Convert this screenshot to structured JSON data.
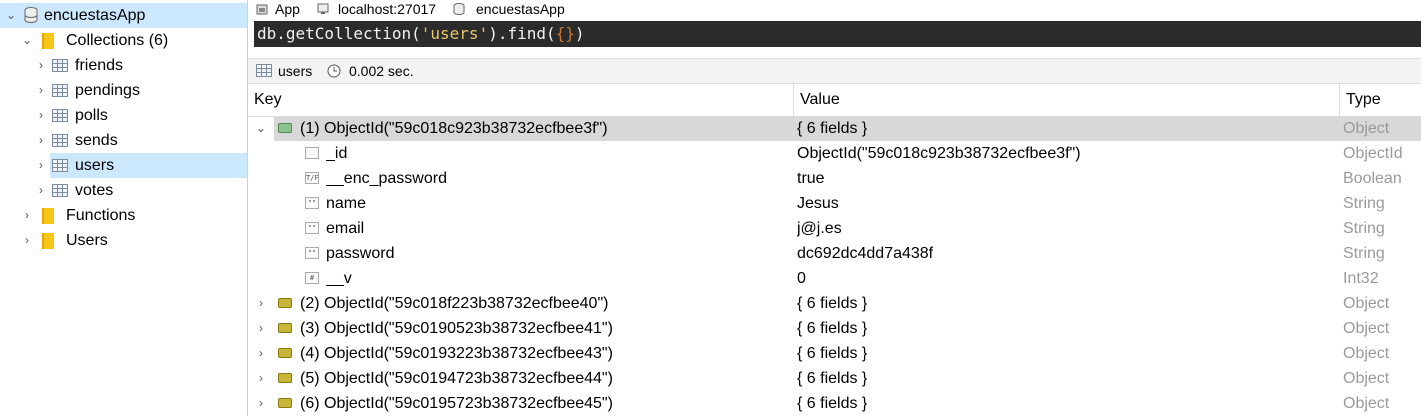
{
  "sidebar": {
    "db_name": "encuestasApp",
    "collections_label": "Collections (6)",
    "collections": [
      "friends",
      "pendings",
      "polls",
      "sends",
      "users",
      "votes"
    ],
    "selected_collection": "users",
    "functions_label": "Functions",
    "users_label": "Users"
  },
  "connection": {
    "app": "App",
    "host": "localhost:27017",
    "db": "encuestasApp"
  },
  "query": {
    "prefix": "db.getCollection(",
    "collection": "'users'",
    "mid": ").find(",
    "arg": "{}",
    "suffix": ")"
  },
  "status": {
    "collection": "users",
    "time": "0.002 sec."
  },
  "grid": {
    "columns": [
      "Key",
      "Value",
      "Type"
    ],
    "expanded": {
      "key": "(1) ObjectId(\"59c018c923b38732ecfbee3f\")",
      "value": "{ 6 fields }",
      "type": "Object",
      "fields": [
        {
          "icon": "objectid-field-icon",
          "glyph": "",
          "key": "_id",
          "value": "ObjectId(\"59c018c923b38732ecfbee3f\")",
          "type": "ObjectId"
        },
        {
          "icon": "boolean-field-icon",
          "glyph": "T/F",
          "key": "__enc_password",
          "value": "true",
          "type": "Boolean"
        },
        {
          "icon": "string-field-icon",
          "glyph": "\"\"",
          "key": "name",
          "value": "Jesus",
          "type": "String"
        },
        {
          "icon": "string-field-icon",
          "glyph": "\"\"",
          "key": "email",
          "value": "j@j.es",
          "type": "String"
        },
        {
          "icon": "string-field-icon",
          "glyph": "\"\"",
          "key": "password",
          "value": "dc692dc4dd7a438f",
          "type": "String"
        },
        {
          "icon": "int-field-icon",
          "glyph": "#",
          "key": "__v",
          "value": "0",
          "type": "Int32"
        }
      ]
    },
    "collapsed": [
      {
        "key": "(2) ObjectId(\"59c018f223b38732ecfbee40\")",
        "value": "{ 6 fields }",
        "type": "Object"
      },
      {
        "key": "(3) ObjectId(\"59c0190523b38732ecfbee41\")",
        "value": "{ 6 fields }",
        "type": "Object"
      },
      {
        "key": "(4) ObjectId(\"59c0193223b38732ecfbee43\")",
        "value": "{ 6 fields }",
        "type": "Object"
      },
      {
        "key": "(5) ObjectId(\"59c0194723b38732ecfbee44\")",
        "value": "{ 6 fields }",
        "type": "Object"
      },
      {
        "key": "(6) ObjectId(\"59c0195723b38732ecfbee45\")",
        "value": "{ 6 fields }",
        "type": "Object"
      }
    ]
  }
}
